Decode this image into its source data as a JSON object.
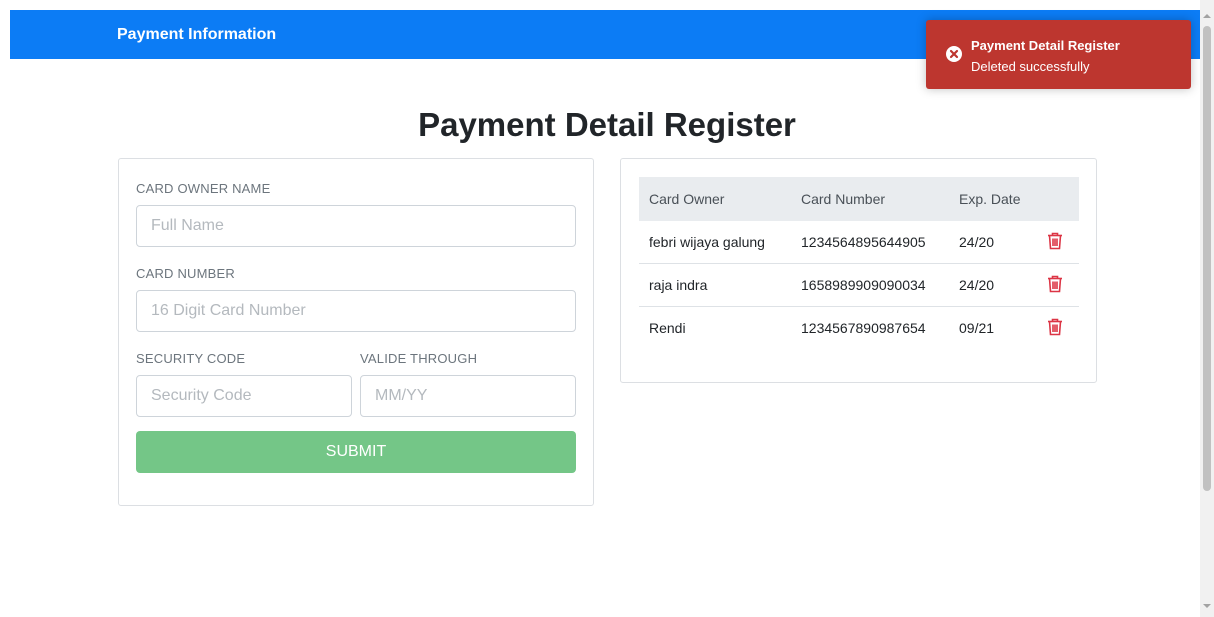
{
  "navbar": {
    "brand": "Payment Information",
    "color": "#0c7cf5"
  },
  "page": {
    "title": "Payment Detail Register"
  },
  "form": {
    "owner_label": "CARD OWNER NAME",
    "owner_placeholder": "Full Name",
    "owner_value": "",
    "number_label": "CARD NUMBER",
    "number_placeholder": "16 Digit Card Number",
    "number_value": "",
    "security_label": "SECURITY CODE",
    "security_placeholder": "Security Code",
    "security_value": "",
    "valid_label": "VALIDE THROUGH",
    "valid_placeholder": "MM/YY",
    "valid_value": "",
    "submit_label": "SUBMIT",
    "submit_color": "#74c687"
  },
  "table": {
    "headers": [
      "Card Owner",
      "Card Number",
      "Exp. Date",
      ""
    ],
    "rows": [
      {
        "owner": "febri wijaya galung",
        "number": "1234564895644905",
        "exp": "24/20",
        "action_icon": "trash-icon"
      },
      {
        "owner": "raja indra",
        "number": "1658989909090034",
        "exp": "24/20",
        "action_icon": "trash-icon"
      },
      {
        "owner": "Rendi",
        "number": "1234567890987654",
        "exp": "09/21",
        "action_icon": "trash-icon"
      }
    ],
    "delete_color": "#dc3545"
  },
  "toast": {
    "title": "Payment Detail Register",
    "message": "Deleted successfully",
    "icon": "error-circle-icon",
    "color": "#bd362f"
  }
}
